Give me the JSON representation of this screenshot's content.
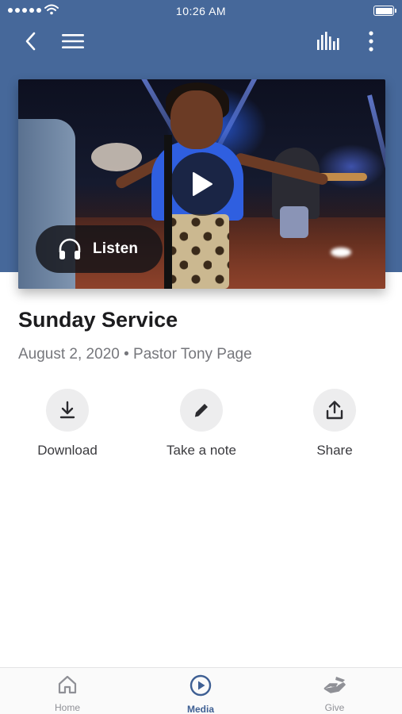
{
  "colors": {
    "header_background": "#46689a",
    "accent": "#3e5f93",
    "title_text": "#1c1c1e",
    "secondary_text": "#76777c"
  },
  "status_bar": {
    "time": "10:26 AM"
  },
  "nav": {
    "back_icon": "chevron-left-icon",
    "menu_icon": "hamburger-menu-icon",
    "audio_icon": "audio-bars-icon",
    "more_icon": "vertical-ellipsis-icon"
  },
  "media": {
    "listen_label": "Listen",
    "play_icon": "play-icon",
    "headphones_icon": "headphones-icon"
  },
  "sermon": {
    "title": "Sunday Service",
    "subtitle": "August 2, 2020 • Pastor Tony Page"
  },
  "actions": [
    {
      "label": "Download",
      "icon": "download-icon"
    },
    {
      "label": "Take a note",
      "icon": "pencil-icon"
    },
    {
      "label": "Share",
      "icon": "share-icon"
    }
  ],
  "tabs": [
    {
      "label": "Home",
      "icon": "home-icon",
      "active": false
    },
    {
      "label": "Media",
      "icon": "play-circle-icon",
      "active": true
    },
    {
      "label": "Give",
      "icon": "give-hand-icon",
      "active": false
    }
  ]
}
